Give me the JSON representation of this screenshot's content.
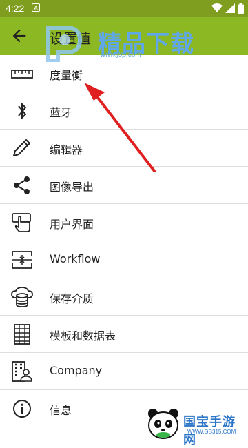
{
  "status_bar": {
    "time": "4:22",
    "notification_glyph": "A",
    "icons": [
      "wifi-icon",
      "signal-icon",
      "battery-icon"
    ]
  },
  "app_bar": {
    "title": "设置值",
    "back_icon": "arrow-left-icon",
    "color": "#8cb824"
  },
  "menu": {
    "items": [
      {
        "label": "度量衡",
        "icon": "ruler-icon"
      },
      {
        "label": "蓝牙",
        "icon": "bluetooth-icon"
      },
      {
        "label": "编辑器",
        "icon": "pencil-icon"
      },
      {
        "label": "图像导出",
        "icon": "share-icon"
      },
      {
        "label": "用户界面",
        "icon": "touch-screen-icon"
      },
      {
        "label": "Workflow",
        "icon": "workflow-icon"
      },
      {
        "label": "保存介质",
        "icon": "cloud-database-icon"
      },
      {
        "label": "模板和数据表",
        "icon": "grid-table-icon"
      },
      {
        "label": "Company",
        "icon": "company-icon"
      },
      {
        "label": "信息",
        "icon": "info-icon"
      }
    ]
  },
  "watermark_top": {
    "text": "精品下载",
    "url": "www.j9p.com"
  },
  "watermark_bottom": {
    "text": "国宝手游网",
    "url": "WWW.GB315.COM"
  },
  "annotation": {
    "arrow_color": "#e02020"
  }
}
